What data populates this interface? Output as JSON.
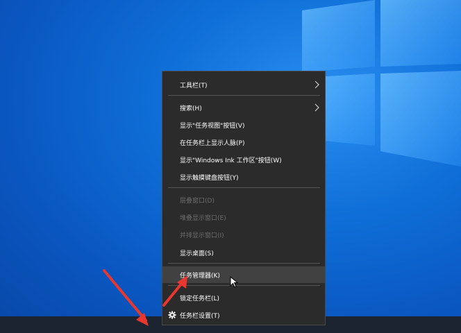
{
  "menu": {
    "items": [
      {
        "label": "工具栏(T)"
      },
      {
        "label": "搜索(H)"
      },
      {
        "label": "显示\"任务视图\"按钮(V)"
      },
      {
        "label": "在任务栏上显示人脉(P)"
      },
      {
        "label": "显示\"Windows Ink 工作区\"按钮(W)"
      },
      {
        "label": "显示触摸键盘按钮(Y)"
      },
      {
        "label": "层叠窗口(D)"
      },
      {
        "label": "堆叠显示窗口(E)"
      },
      {
        "label": "并排显示窗口(I)"
      },
      {
        "label": "显示桌面(S)"
      },
      {
        "label": "任务管理器(K)"
      },
      {
        "label": "锁定任务栏(L)"
      },
      {
        "label": "任务栏设置(T)"
      }
    ]
  },
  "colors": {
    "menu_bg": "#2b2b2b",
    "hover_bg": "#414141",
    "annotation_arrow": "#e8372f",
    "taskbar": "#1c2430"
  },
  "icons": {
    "submenu": "chevron-right-icon",
    "settings": "gear-icon",
    "pointer": "mouse-cursor-icon"
  }
}
